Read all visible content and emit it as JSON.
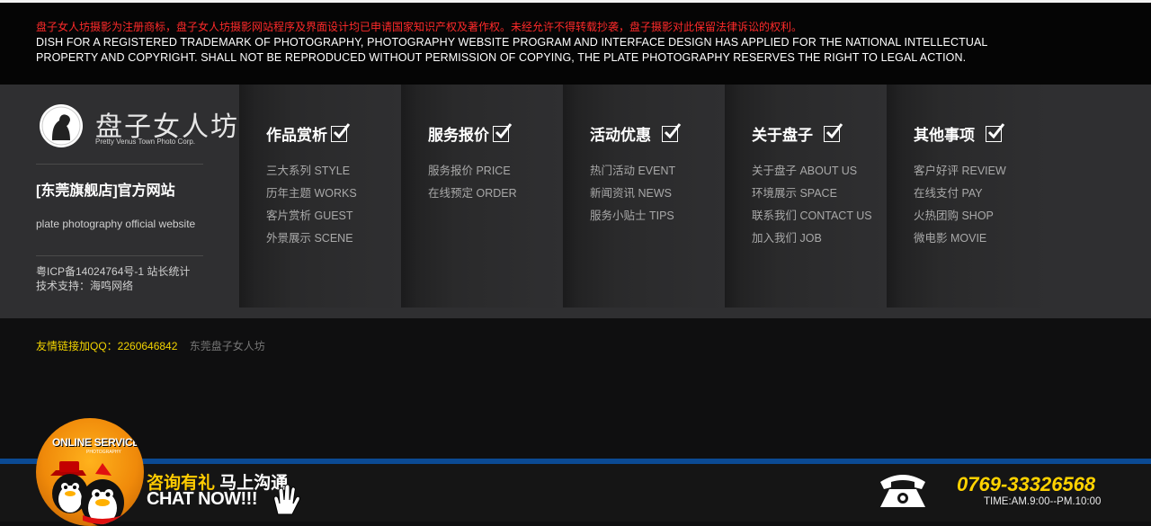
{
  "notice": {
    "cn": "盘子女人坊摄影为注册商标，盘子女人坊摄影网站程序及界面设计均已申请国家知识产权及著作权。未经允许不得转载抄袭，盘子摄影对此保留法律诉讼的权利。",
    "en": "DISH FOR A REGISTERED TRADEMARK OF PHOTOGRAPHY, PHOTOGRAPHY WEBSITE PROGRAM AND INTERFACE DESIGN HAS APPLIED FOR THE NATIONAL INTELLECTUAL PROPERTY AND COPYRIGHT. SHALL NOT BE REPRODUCED WITHOUT PERMISSION OF COPYING, THE PLATE PHOTOGRAPHY RESERVES THE RIGHT TO LEGAL ACTION."
  },
  "brand": {
    "logo_text": "盘子女人坊",
    "logo_sub": "Pretty Venus Town Photo Corp.",
    "store_title": "[东莞旗舰店]官方网站",
    "store_sub": "plate photography official website",
    "icp_line1": "粤ICP备14024764号-1 站长统计",
    "icp_line2": "技术支持：海鸣网络"
  },
  "columns": [
    {
      "title": "作品赏析",
      "links": [
        "三大系列 STYLE",
        "历年主题 WORKS",
        "客片赏析 GUEST",
        "外景展示 SCENE"
      ]
    },
    {
      "title": "服务报价",
      "links": [
        "服务报价 PRICE",
        "在线预定 ORDER"
      ]
    },
    {
      "title": "活动优惠",
      "links": [
        "热门活动 EVENT",
        "新闻资讯 NEWS",
        "服务小贴士 TIPS"
      ]
    },
    {
      "title": "关于盘子",
      "links": [
        "关于盘子 ABOUT US",
        "环境展示 SPACE",
        "联系我们 CONTACT US",
        "加入我们 JOB"
      ]
    },
    {
      "title": "其他事项",
      "links": [
        "客户好评 REVIEW",
        "在线支付 PAY",
        "火热团购 SHOP",
        "微电影 MOVIE"
      ]
    }
  ],
  "friend_links": {
    "label": "友情链接加QQ：2260646842",
    "site": "东莞盘子女人坊"
  },
  "chat": {
    "badge_title": "ONLINE SERVICE",
    "badge_sub": "PHOTOGRAPHY",
    "cn_highlight": "咨询有礼",
    "cn_rest": " 马上沟通",
    "en": "CHAT NOW!!!",
    "phone": "0769-33326568",
    "hours": "TIME:AM.9:00--PM.10:00"
  },
  "colors": {
    "notice_red": "#ff2a2a",
    "accent_yellow": "#ffd200",
    "bar_blue": "#0b4a93"
  }
}
